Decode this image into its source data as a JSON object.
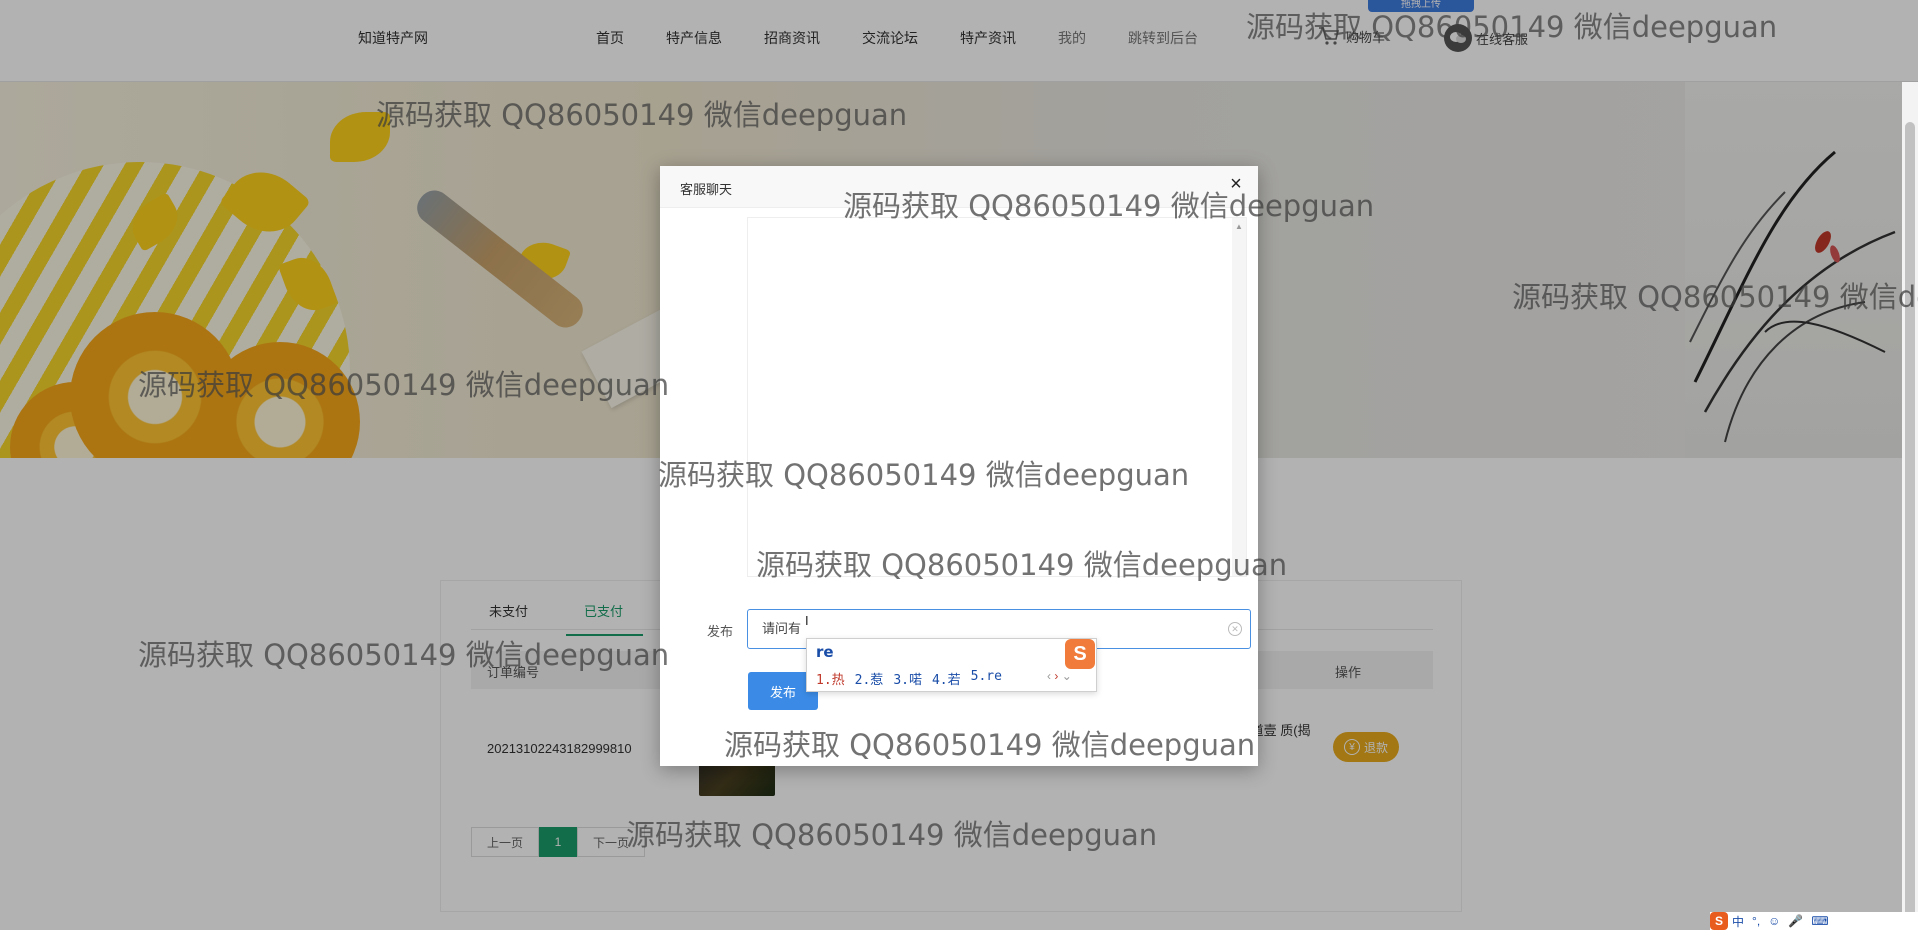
{
  "nav": {
    "logo": "知道特产网",
    "items": [
      "首页",
      "特产信息",
      "招商资讯",
      "交流论坛",
      "特产资讯",
      "我的",
      "跳转到后台"
    ],
    "cart": "购物车",
    "service": "在线客服",
    "upload_badge": "拖拽上传"
  },
  "orders": {
    "tabs": [
      "未支付",
      "已支付"
    ],
    "active_tab": "已支付",
    "col_order_no": "订单编号",
    "col_action": "操作",
    "rows": [
      {
        "order_no": "20213102243182999810",
        "address": "阳市榕 街道壹 质(揭阳店)",
        "action": "退款"
      }
    ],
    "pager": {
      "prev": "上一页",
      "current": "1",
      "next": "下一页"
    }
  },
  "modal": {
    "title": "客服聊天",
    "close": "×",
    "publish_label": "发布",
    "input_value": "请问有",
    "publish_button": "发布"
  },
  "ime": {
    "input": "re",
    "candidates": [
      "1.热",
      "2.惹",
      "3.喏",
      "4.若",
      "5.re"
    ],
    "logo": "S"
  },
  "tray": {
    "items": [
      "中",
      "°,",
      "☺",
      "🎤",
      "⌨"
    ]
  },
  "watermark": {
    "text": "源码获取 QQ86050149 微信deepguan"
  },
  "colors": {
    "accent_green": "#1a9d6b",
    "button_blue": "#3b8be6",
    "refund_gold": "#e8ab1e"
  }
}
